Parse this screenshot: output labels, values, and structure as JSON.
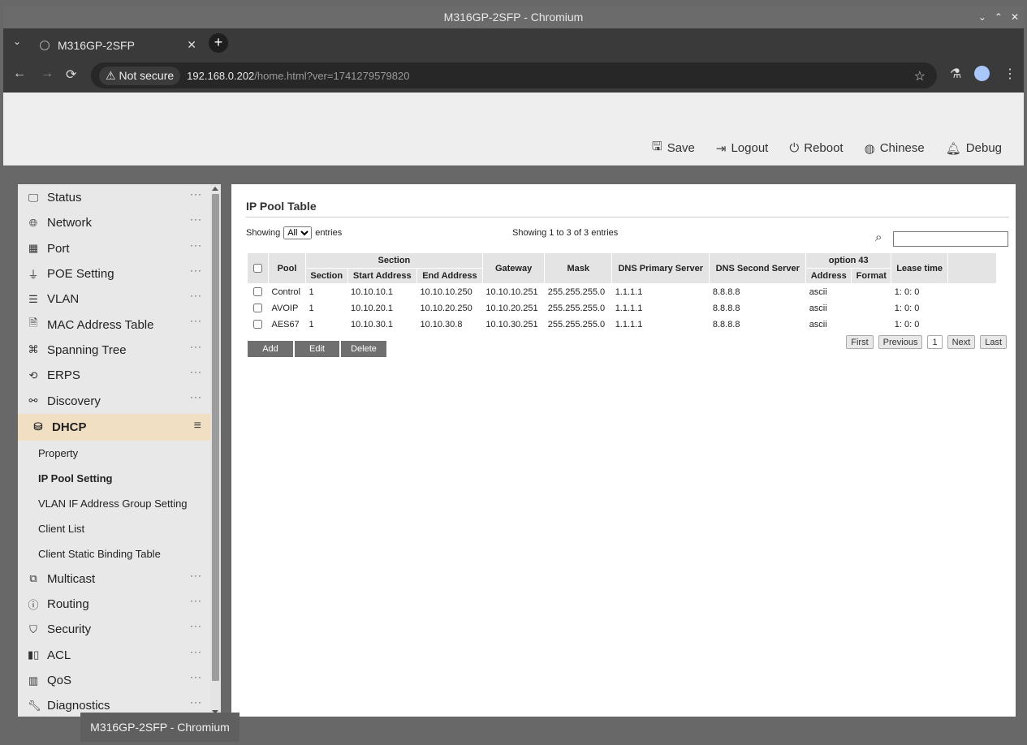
{
  "window": {
    "title": "M316GP-2SFP - Chromium",
    "controls": [
      "⌄",
      "⌃",
      "✕"
    ]
  },
  "browser": {
    "tab_title": "M316GP-2SFP",
    "security_label": "Not secure",
    "url_host": "192.168.0.202",
    "url_path": "/home.html?ver=1741279579820"
  },
  "header": {
    "actions": [
      {
        "label": "Save",
        "icon": "save-icon"
      },
      {
        "label": "Logout",
        "icon": "logout-icon"
      },
      {
        "label": "Reboot",
        "icon": "power-icon"
      },
      {
        "label": "Chinese",
        "icon": "language-icon"
      },
      {
        "label": "Debug",
        "icon": "bell-icon"
      }
    ]
  },
  "sidebar": {
    "items": [
      {
        "label": "Status",
        "icon": "monitor-icon"
      },
      {
        "label": "Network",
        "icon": "globe-icon"
      },
      {
        "label": "Port",
        "icon": "port-icon"
      },
      {
        "label": "POE Setting",
        "icon": "plug-icon"
      },
      {
        "label": "VLAN",
        "icon": "list-icon"
      },
      {
        "label": "MAC Address Table",
        "icon": "receipt-icon"
      },
      {
        "label": "Spanning Tree",
        "icon": "tree-icon"
      },
      {
        "label": "ERPS",
        "icon": "ring-icon"
      },
      {
        "label": "Discovery",
        "icon": "hierarchy-icon"
      },
      {
        "label": "DHCP",
        "icon": "database-icon",
        "active": true
      }
    ],
    "sub_items": [
      {
        "label": "Property"
      },
      {
        "label": "IP Pool Setting",
        "current": true
      },
      {
        "label": "VLAN IF Address Group Setting"
      },
      {
        "label": "Client List"
      },
      {
        "label": "Client Static Binding Table"
      }
    ],
    "items_after": [
      {
        "label": "Multicast",
        "icon": "multicast-icon"
      },
      {
        "label": "Routing",
        "icon": "ip-icon"
      },
      {
        "label": "Security",
        "icon": "shield-icon"
      },
      {
        "label": "ACL",
        "icon": "acl-icon"
      },
      {
        "label": "QoS",
        "icon": "qos-icon"
      },
      {
        "label": "Diagnostics",
        "icon": "wrench-icon"
      }
    ]
  },
  "panel": {
    "title": "IP Pool Table",
    "showing_label": "Showing",
    "entries_label": "entries",
    "page_size": "All",
    "info": "Showing 1 to 3 of 3 entries",
    "columns": {
      "pool": "Pool",
      "section_group": "Section",
      "section": "Section",
      "start": "Start Address",
      "end": "End Address",
      "gateway": "Gateway",
      "mask": "Mask",
      "dns1": "DNS Primary Server",
      "dns2": "DNS Second Server",
      "opt43": "option 43",
      "opt43_address": "Address",
      "opt43_format": "Format",
      "lease": "Lease time"
    },
    "rows": [
      {
        "pool": "Control",
        "section": "1",
        "start": "10.10.10.1",
        "end": "10.10.10.250",
        "gateway": "10.10.10.251",
        "mask": "255.255.255.0",
        "dns1": "1.1.1.1",
        "dns2": "8.8.8.8",
        "address": "ascii",
        "format": "",
        "lease": "1: 0: 0"
      },
      {
        "pool": "AVOIP",
        "section": "1",
        "start": "10.10.20.1",
        "end": "10.10.20.250",
        "gateway": "10.10.20.251",
        "mask": "255.255.255.0",
        "dns1": "1.1.1.1",
        "dns2": "8.8.8.8",
        "address": "ascii",
        "format": "",
        "lease": "1: 0: 0"
      },
      {
        "pool": "AES67",
        "section": "1",
        "start": "10.10.30.1",
        "end": "10.10.30.8",
        "gateway": "10.10.30.251",
        "mask": "255.255.255.0",
        "dns1": "1.1.1.1",
        "dns2": "8.8.8.8",
        "address": "ascii",
        "format": "",
        "lease": "1: 0: 0"
      }
    ],
    "buttons": {
      "add": "Add",
      "edit": "Edit",
      "delete": "Delete"
    },
    "pager": {
      "first": "First",
      "previous": "Previous",
      "page": "1",
      "next": "Next",
      "last": "Last"
    }
  },
  "taskbar": {
    "tooltip": "M316GP-2SFP - Chromium"
  }
}
